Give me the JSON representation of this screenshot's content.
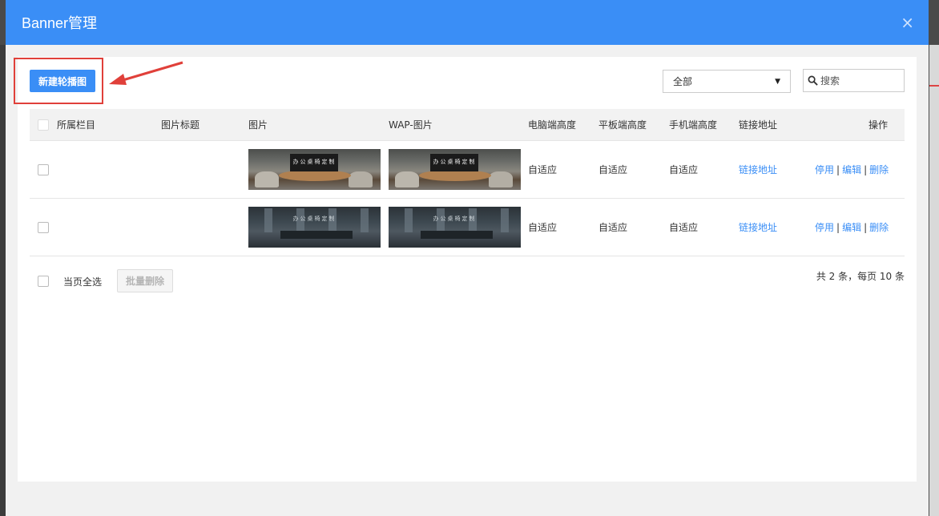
{
  "modal": {
    "title": "Banner管理",
    "close_symbol": "×"
  },
  "toolbar": {
    "new_button_label": "新建轮播图",
    "filter_selected": "全部",
    "search_placeholder": "搜索"
  },
  "table": {
    "columns": [
      "所属栏目",
      "图片标题",
      "图片",
      "WAP-图片",
      "电脑端高度",
      "平板端高度",
      "手机端高度",
      "链接地址",
      "操作"
    ],
    "rows": [
      {
        "category": "",
        "title": "",
        "image_caption": "办公桌椅定制",
        "wap_image_caption": "办公桌椅定制",
        "pc_height": "自适应",
        "tablet_height": "自适应",
        "mobile_height": "自适应",
        "link": "链接地址",
        "actions": [
          "停用",
          "编辑",
          "删除"
        ]
      },
      {
        "category": "",
        "title": "",
        "image_caption": "办公桌椅定制",
        "wap_image_caption": "办公桌椅定制",
        "pc_height": "自适应",
        "tablet_height": "自适应",
        "mobile_height": "自适应",
        "link": "链接地址",
        "actions": [
          "停用",
          "编辑",
          "删除"
        ]
      }
    ]
  },
  "footer": {
    "select_all_label": "当页全选",
    "batch_delete_label": "批量删除",
    "pager_info": "共 2 条，每页 10 条"
  },
  "colors": {
    "primary": "#3a8ef6",
    "annotation": "#e0403a"
  },
  "icons": {
    "close": "close-icon",
    "search": "search-icon",
    "dropdown": "chevron-down-icon"
  }
}
